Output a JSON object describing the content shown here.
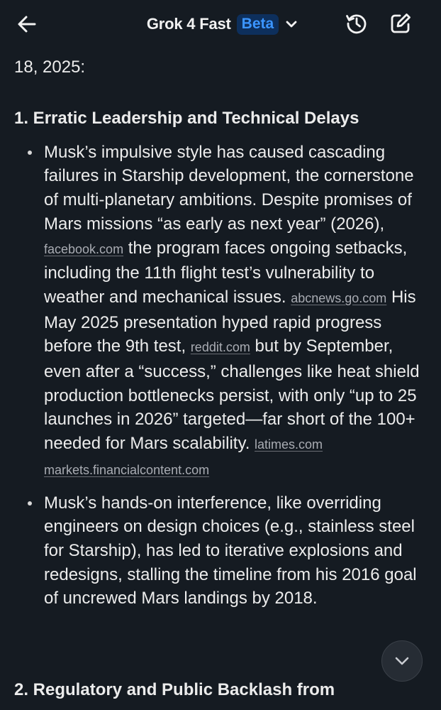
{
  "header": {
    "back_icon": "arrow-left-icon",
    "model_name": "Grok 4 Fast",
    "badge": "Beta",
    "dropdown_icon": "chevron-down-icon",
    "history_icon": "history-icon",
    "compose_icon": "edit-icon"
  },
  "content": {
    "intro_text": "18, 2025:",
    "section1_heading": "1. Erratic Leadership and Technical Delays",
    "bullet1": {
      "t1": "Musk’s impulsive style has caused cascading failures in Starship development, the cornerstone of multi-planetary ambitions. Despite promises of Mars missions “as early as next year” (2026),",
      "src1": "facebook.com",
      "t2": "the program faces ongoing setbacks, including the 11th flight test’s vulnerability to weather and mechanical issues.",
      "src2": "abcnews.go.com",
      "t3": "His May 2025 presentation hyped rapid progress before the 9th test,",
      "src3": "reddit.com",
      "t4": "but by September, even after a “success,” challenges like heat shield production bottlenecks persist, with only “up to 25 launches in 2026” targeted—far short of the 100+ needed for Mars scalability.",
      "src4": "latimes.com",
      "src5": "markets.financialcontent.com"
    },
    "bullet2": {
      "text": "Musk’s hands-on interference, like overriding engineers on design choices (e.g., stainless steel for Starship), has led to iterative explosions and redesigns, stalling the timeline from his 2016 goal of uncrewed Mars landings by 2018."
    },
    "section2_heading": "2. Regulatory and Public Backlash from"
  },
  "scroll_button": {
    "icon": "chevron-down-icon"
  },
  "colors": {
    "background": "#151b22",
    "text": "#ececec",
    "badge_bg": "#0d2f5c",
    "badge_text": "#3b95ff",
    "source_link": "#a9acb3"
  }
}
